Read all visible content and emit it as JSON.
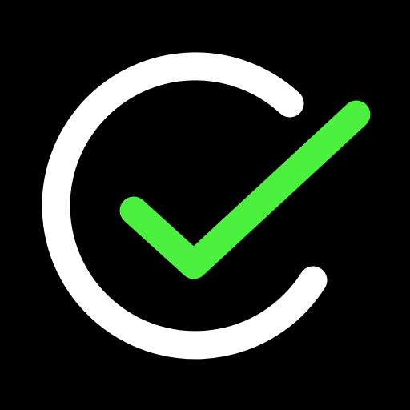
{
  "icon": {
    "name": "check-circle-logo-icon",
    "background_color": "#000000",
    "ring_color": "#ffffff",
    "check_color": "#4cf03f"
  }
}
